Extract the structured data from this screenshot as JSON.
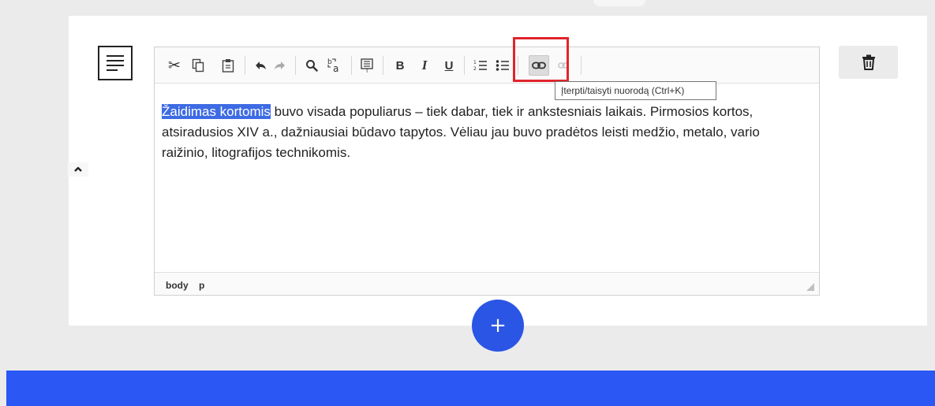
{
  "editor": {
    "content": {
      "selected_text": "Žaidimas kortomis",
      "rest_text": " buvo visada populiarus – tiek dabar, tiek ir ankstesniais laikais. Pirmosios kortos, atsiradusios XIV a., dažniausiai būdavo tapytos. Vėliau jau buvo pradėtos leisti medžio, metalo, vario raižinio, litografijos technikomis."
    },
    "toolbar": {
      "bold_label": "B",
      "italic_label": "I",
      "underline_label": "U"
    },
    "path": [
      "body",
      "p"
    ],
    "tooltip": "Įterpti/taisyti nuorodą (Ctrl+K)"
  },
  "add_button_label": "+",
  "colors": {
    "accent": "#2a55e5",
    "footer": "#2b57f5",
    "selection": "#3d6be3",
    "highlight_frame": "#e1242b"
  },
  "icons": [
    "text-block-icon",
    "chevron-up-icon",
    "cut-icon",
    "copy-icon",
    "paste-icon",
    "undo-icon",
    "redo-icon",
    "search-icon",
    "replace-icon",
    "paste-text-icon",
    "numbered-list-icon",
    "bullet-list-icon",
    "link-icon",
    "unlink-icon",
    "trash-icon"
  ]
}
